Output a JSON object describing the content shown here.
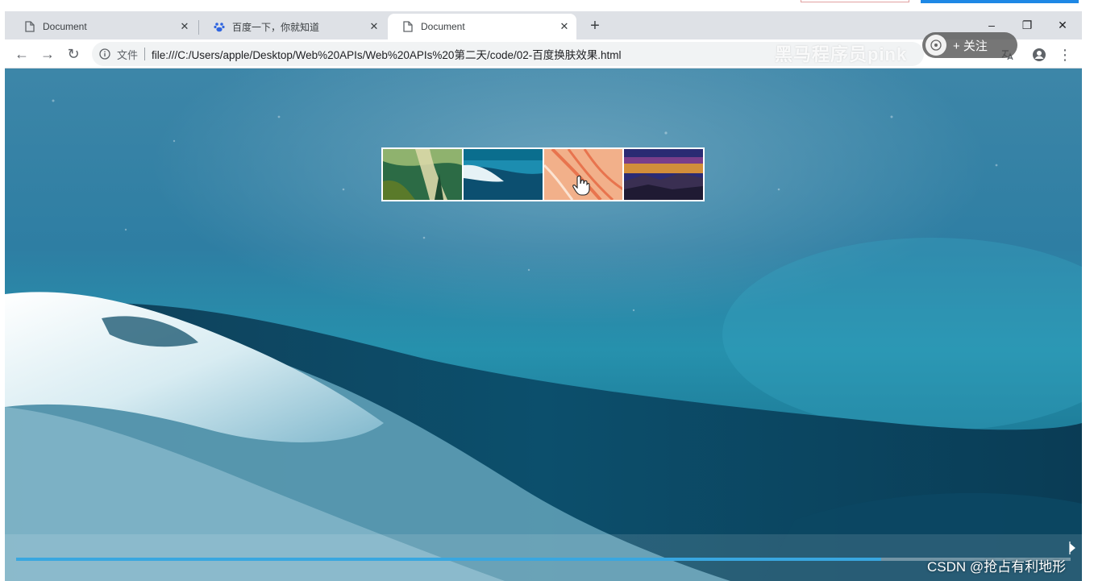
{
  "browser": {
    "tabs": [
      {
        "label": "Document",
        "icon": "document-icon",
        "active": false
      },
      {
        "label": "百度一下，你就知道",
        "icon": "baidu-paw-icon",
        "active": false
      },
      {
        "label": "Document",
        "icon": "document-icon",
        "active": true
      }
    ],
    "close_glyph": "✕",
    "new_tab_glyph": "+",
    "window_controls": {
      "minimize": "–",
      "restore": "❐",
      "close": "✕"
    }
  },
  "toolbar": {
    "back_glyph": "←",
    "forward_glyph": "→",
    "reload_glyph": "↻",
    "security_label": "文件",
    "url": "file:///C:/Users/apple/Desktop/Web%20APIs/Web%20APIs%20第二天/code/02-百度换肤效果.html",
    "menu_glyph": "⋮"
  },
  "overlay": {
    "watermark": "黑马程序员pink",
    "follow_label": "+ 关注"
  },
  "thumbnails": [
    {
      "name": "forest-waterfall",
      "colors": [
        "#2c6b45",
        "#8fb26e",
        "#d9d7a7"
      ]
    },
    {
      "name": "ocean-wave",
      "colors": [
        "#0c4f70",
        "#1c8db0",
        "#e6f2f6"
      ]
    },
    {
      "name": "pink-feather",
      "colors": [
        "#f2b08a",
        "#e8744e",
        "#fbe3d2"
      ]
    },
    {
      "name": "sunset-mountains",
      "colors": [
        "#2b2b73",
        "#f0a030",
        "#7a3e8a"
      ]
    }
  ],
  "video": {
    "progress": 0.82
  },
  "csdn_watermark": "CSDN @抢占有利地形",
  "colors": {
    "accent": "#39a7e0",
    "chrome": "#dee1e6"
  }
}
